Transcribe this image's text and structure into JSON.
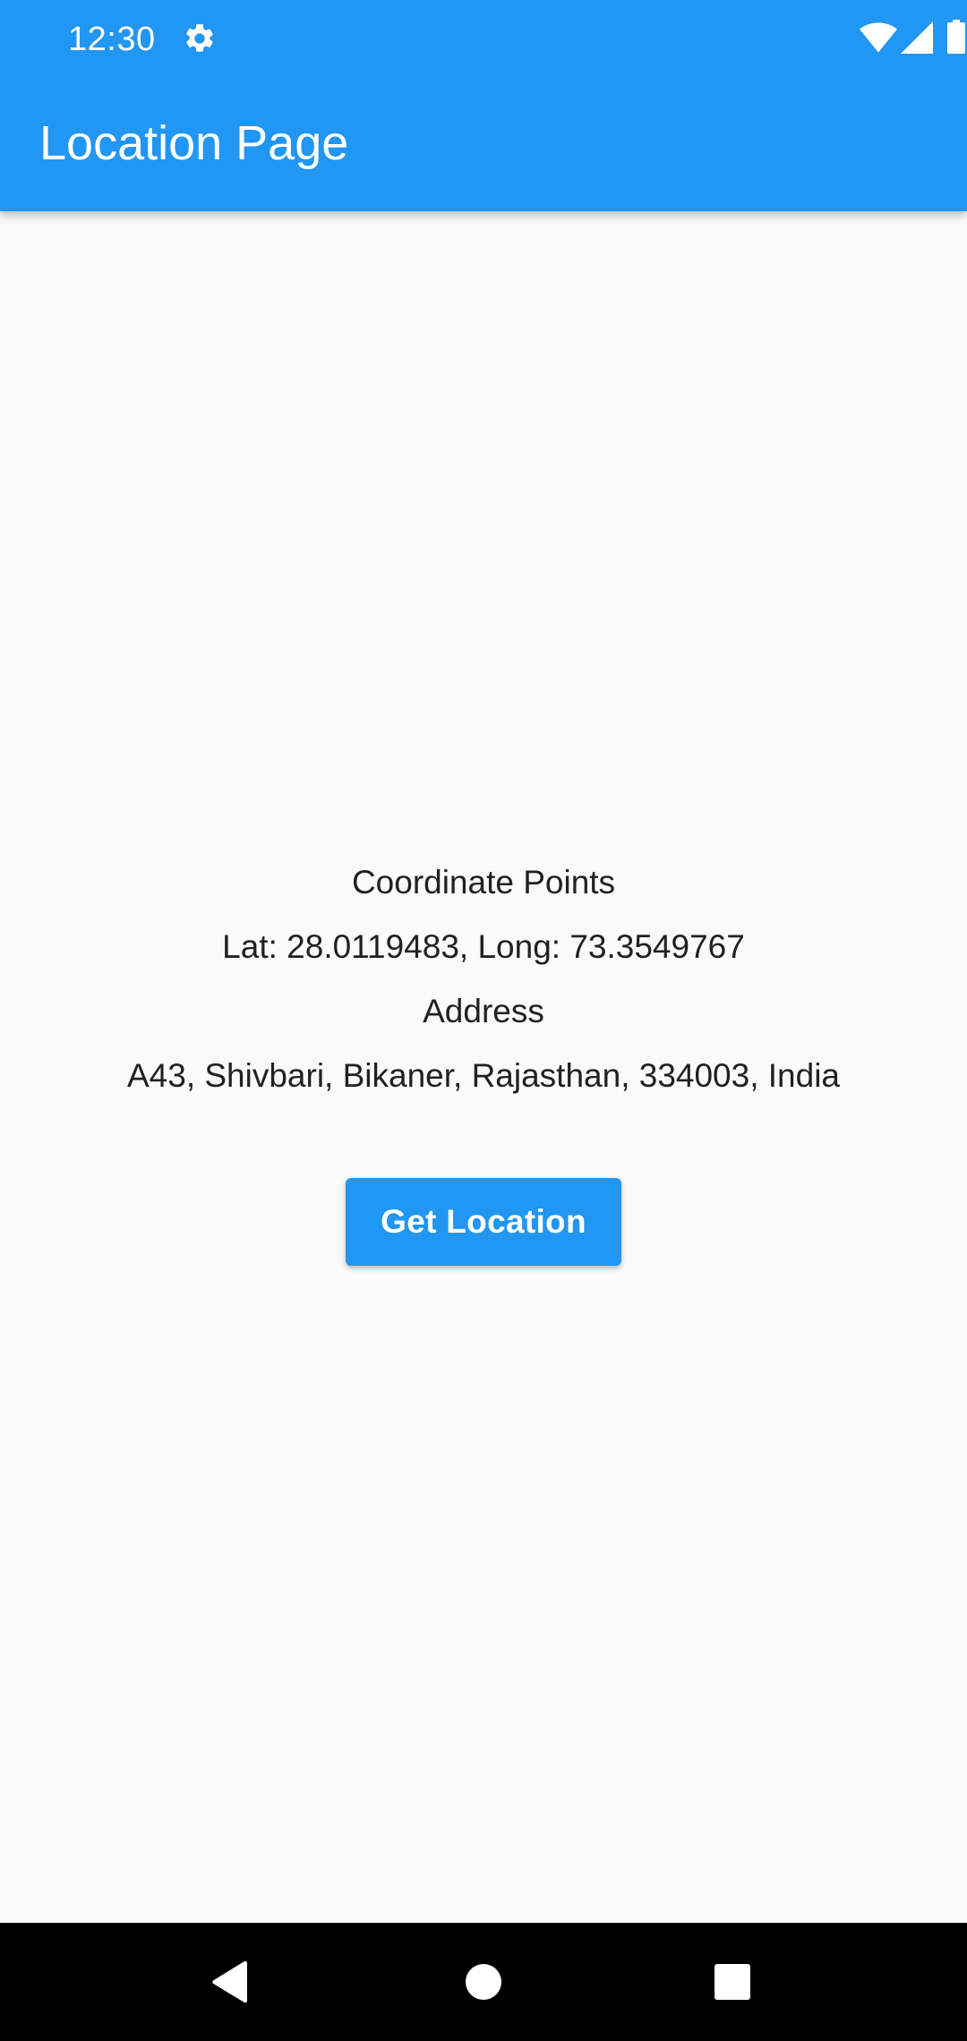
{
  "status_bar": {
    "time": "12:30",
    "icons": [
      "gear-icon",
      "wifi-icon",
      "cellular-signal-icon",
      "battery-icon"
    ]
  },
  "app_bar": {
    "title": "Location Page"
  },
  "content": {
    "coordinate_heading": "Coordinate Points",
    "coordinates": "Lat: 28.0119483, Long: 73.3549767",
    "address_heading": "Address",
    "address": "A43, Shivbari, Bikaner, Rajasthan, 334003, India",
    "button_label": "Get Location"
  },
  "nav_bar": {
    "icons": [
      "back-icon",
      "home-icon",
      "recents-icon"
    ]
  },
  "colors": {
    "primary": "#2196f3",
    "background": "#fafafa",
    "text": "#212121",
    "nav_bar": "#000000"
  }
}
